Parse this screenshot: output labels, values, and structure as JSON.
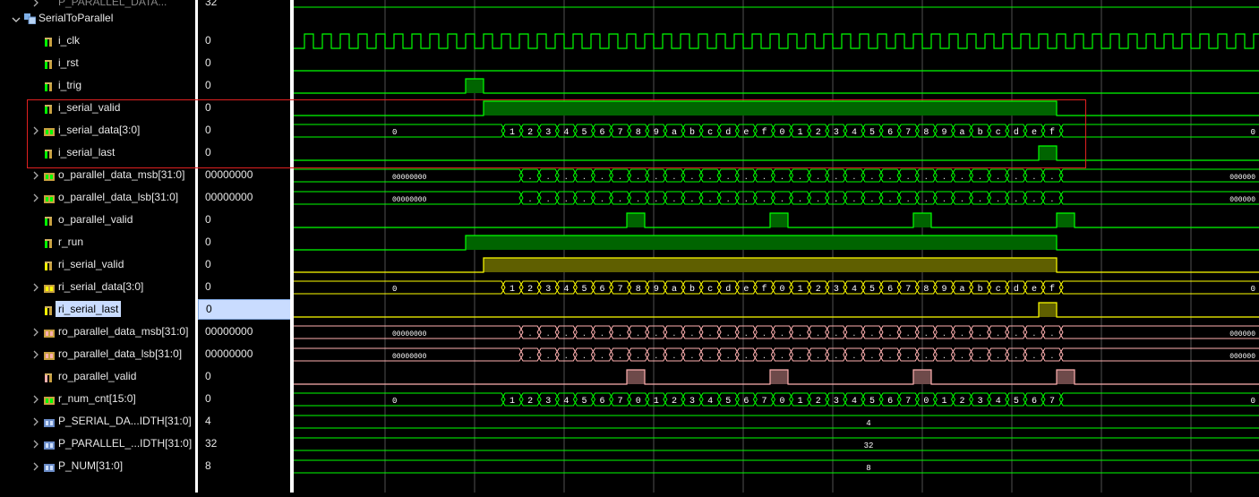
{
  "module_name": "SerialToParallel",
  "partial_top_row": {
    "name": "P_PARALLEL_DATA...",
    "value": "32"
  },
  "signals": [
    {
      "name": "i_clk",
      "value": "0",
      "type": "bit",
      "color": "#00ff00"
    },
    {
      "name": "i_rst",
      "value": "0",
      "type": "bit",
      "color": "#00ff00"
    },
    {
      "name": "i_trig",
      "value": "0",
      "type": "bit",
      "color": "#00ff00"
    },
    {
      "name": "i_serial_valid",
      "value": "0",
      "type": "bit",
      "color": "#00ff00"
    },
    {
      "name": "i_serial_data[3:0]",
      "value": "0",
      "type": "bus",
      "color": "#00ff00"
    },
    {
      "name": "i_serial_last",
      "value": "0",
      "type": "bit",
      "color": "#00ff00"
    },
    {
      "name": "o_parallel_data_msb[31:0]",
      "value": "00000000",
      "type": "bus",
      "color": "#00ff00"
    },
    {
      "name": "o_parallel_data_lsb[31:0]",
      "value": "00000000",
      "type": "bus",
      "color": "#00ff00"
    },
    {
      "name": "o_parallel_valid",
      "value": "0",
      "type": "bit",
      "color": "#00ff00"
    },
    {
      "name": "r_run",
      "value": "0",
      "type": "bit",
      "color": "#00ff00"
    },
    {
      "name": "ri_serial_valid",
      "value": "0",
      "type": "bit",
      "color": "#ffff00"
    },
    {
      "name": "ri_serial_data[3:0]",
      "value": "0",
      "type": "bus",
      "color": "#ffff00"
    },
    {
      "name": "ri_serial_last",
      "value": "0",
      "type": "bit",
      "color": "#ffff00",
      "selected": true
    },
    {
      "name": "ro_parallel_data_msb[31:0]",
      "value": "00000000",
      "type": "bus",
      "color": "#ffb0b0"
    },
    {
      "name": "ro_parallel_data_lsb[31:0]",
      "value": "00000000",
      "type": "bus",
      "color": "#ffb0b0"
    },
    {
      "name": "ro_parallel_valid",
      "value": "0",
      "type": "bit",
      "color": "#ffb0b0"
    },
    {
      "name": "r_num_cnt[15:0]",
      "value": "0",
      "type": "bus",
      "color": "#00ff00"
    },
    {
      "name": "P_SERIAL_DA...IDTH[31:0]",
      "value": "4",
      "type": "param",
      "color": "#00ff00"
    },
    {
      "name": "P_PARALLEL_...IDTH[31:0]",
      "value": "32",
      "type": "param",
      "color": "#00ff00"
    },
    {
      "name": "P_NUM[31:0]",
      "value": "8",
      "type": "param",
      "color": "#00ff00"
    }
  ],
  "wave_labels": {
    "serial_data_idle_left": "0",
    "serial_data_idle_right": "0",
    "serial_data_seq": [
      "1",
      "2",
      "3",
      "4",
      "5",
      "6",
      "7",
      "8",
      "9",
      "a",
      "b",
      "c",
      "d",
      "e",
      "f",
      "0",
      "1",
      "2",
      "3",
      "4",
      "5",
      "6",
      "7",
      "8",
      "9",
      "a",
      "b",
      "c",
      "d",
      "e",
      "f"
    ],
    "parallel_idle_left": "00000000",
    "parallel_idle_right": "000000",
    "parallel_seq_dot": ".",
    "num_cnt_idle_left": "0",
    "num_cnt_idle_right": "0",
    "num_cnt_seq": [
      "1",
      "2",
      "3",
      "4",
      "5",
      "6",
      "7",
      "0",
      "1",
      "2",
      "3",
      "4",
      "5",
      "6",
      "7",
      "0",
      "1",
      "2",
      "3",
      "4",
      "5",
      "6",
      "7",
      "0",
      "1",
      "2",
      "3",
      "4",
      "5",
      "6",
      "7"
    ],
    "param_serial_width": "4",
    "param_parallel_width": "32",
    "param_num": "8"
  },
  "colors": {
    "signal_green": "#00ff00",
    "signal_yellow": "#ffff00",
    "signal_pink": "#ffb0b0",
    "high_fill_green": "#006400",
    "high_fill_yellow": "#5f5f00",
    "high_fill_pink": "#6e4a4a",
    "gridline": "#505050",
    "highlight_box": "#e02020",
    "selection": "#c9dcff"
  },
  "icons": {
    "expand": "chevron-right-icon",
    "collapse": "chevron-down-icon",
    "module": "module-icon",
    "bit_signal": "bit-signal-icon",
    "bus_signal": "bus-signal-icon",
    "param": "param-icon"
  }
}
